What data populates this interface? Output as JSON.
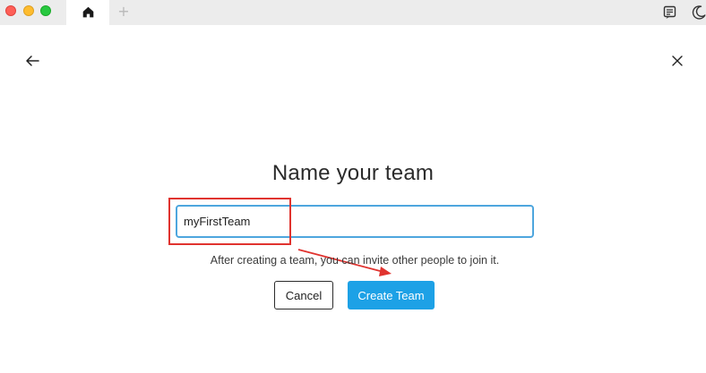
{
  "window": {
    "tabs": [
      {
        "icon": "home-icon",
        "active": true
      },
      {
        "icon": "plus-icon",
        "label": "+"
      }
    ],
    "toolbar_icons": [
      "notes-icon",
      "dark-mode-moon-icon"
    ]
  },
  "dialog": {
    "title": "Name your team",
    "team_name_value": "myFirstTeam",
    "helper_text": "After creating a team, you can invite other people to join it.",
    "cancel_label": "Cancel",
    "create_label": "Create Team"
  },
  "colors": {
    "accent": "#1da1e6",
    "input_focus_border": "#4ea6de",
    "annotation": "#e0332f"
  }
}
